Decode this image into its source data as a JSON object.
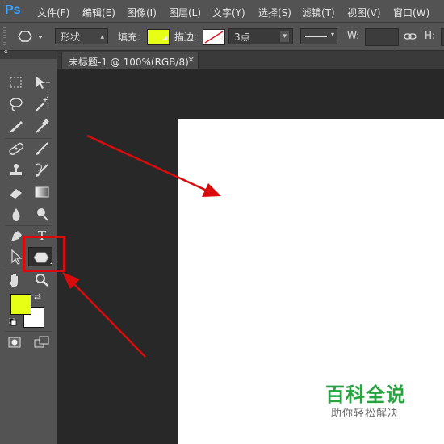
{
  "app": {
    "logo": "Ps"
  },
  "menu": [
    {
      "label": "文件(F)"
    },
    {
      "label": "编辑(E)"
    },
    {
      "label": "图像(I)"
    },
    {
      "label": "图层(L)"
    },
    {
      "label": "文字(Y)"
    },
    {
      "label": "选择(S)"
    },
    {
      "label": "滤镜(T)"
    },
    {
      "label": "视图(V)"
    },
    {
      "label": "窗口(W)"
    }
  ],
  "options": {
    "mode_value": "形状",
    "fill_label": "填充:",
    "fill_color": "#e6ff14",
    "stroke_label": "描边:",
    "stroke_size_value": "3点",
    "width_label": "W:",
    "height_label": "H:"
  },
  "document": {
    "tab_title": "未标题-1 @ 100%(RGB/8)",
    "close_glyph": "×",
    "canvas_color": "#ffffff"
  },
  "colors": {
    "foreground": "#e6ff14",
    "background": "#ffffff",
    "annotation": "#d80c0c"
  },
  "tools": [
    "marquee-tool",
    "move-tool",
    "lasso-tool",
    "magic-wand-tool",
    "crop-tool",
    "eyedropper-tool",
    "spot-healing-tool",
    "brush-tool",
    "clone-stamp-tool",
    "history-brush-tool",
    "eraser-tool",
    "gradient-tool",
    "blur-tool",
    "dodge-tool",
    "pen-tool",
    "type-tool",
    "path-selection-tool",
    "polygon-shape-tool",
    "hand-tool",
    "zoom-tool",
    "quick-mask-tool",
    "screen-mode-tool"
  ],
  "watermark": {
    "title": "百科全说",
    "subtitle": "助你轻松解决"
  }
}
